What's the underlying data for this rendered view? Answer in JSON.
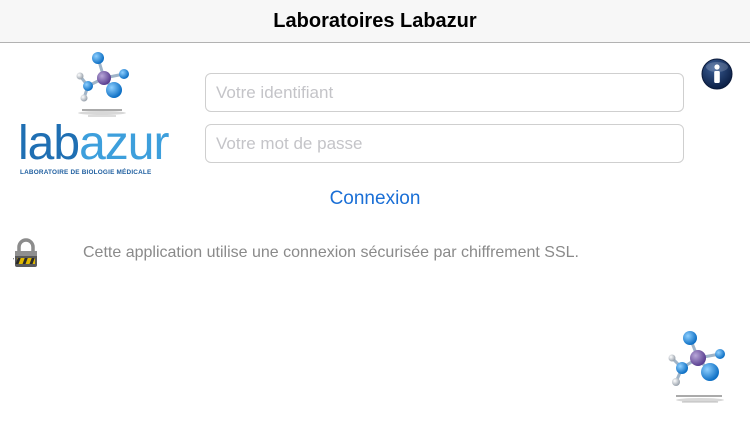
{
  "navbar": {
    "title": "Laboratoires Labazur"
  },
  "logo": {
    "word_part1": "lab",
    "word_part2": "azur",
    "subtitle": "LABORATOIRE DE BIOLOGIE MÉDICALE",
    "colors": {
      "dark_blue": "#1f6fb3",
      "light_blue": "#3d9fdc"
    }
  },
  "form": {
    "login_placeholder": "Votre identifiant",
    "login_value": "",
    "password_placeholder": "Votre mot de passe",
    "password_value": "",
    "connect_label": "Connexion"
  },
  "security": {
    "message": "Cette application utilise une connexion sécurisée par chiffrement SSL."
  },
  "icons": {
    "info": "info-icon",
    "lock": "padlock-icon",
    "molecule": "molecule-icon"
  },
  "colors": {
    "accent": "#1a6fd6",
    "navbar_bg": "#f7f7f7",
    "info_bg": "#0e2a5c"
  }
}
